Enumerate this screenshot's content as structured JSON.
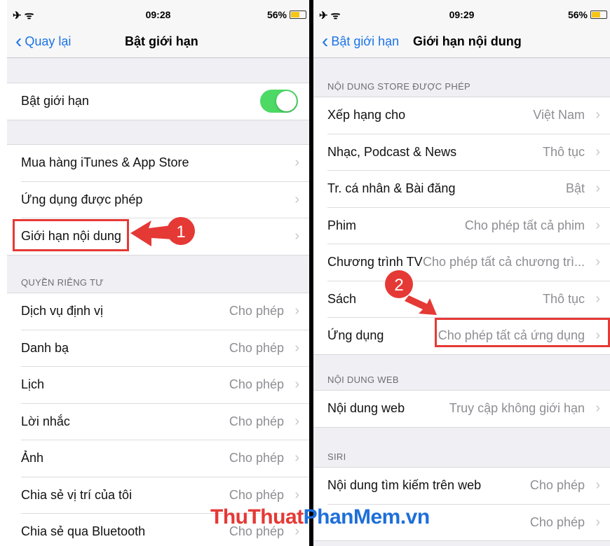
{
  "left": {
    "status": {
      "time": "09:28",
      "battery": "56%",
      "icons": "✈ ᯤ"
    },
    "nav": {
      "back": "Quay lại",
      "title": "Bật giới hạn"
    },
    "toggle_row": {
      "label": "Bật giới hạn",
      "on": true
    },
    "group1": [
      {
        "label": "Mua hàng iTunes & App Store"
      },
      {
        "label": "Ứng dụng được phép"
      },
      {
        "label": "Giới hạn nội dung"
      }
    ],
    "privacy_header": "QUYỀN RIÊNG TƯ",
    "privacy": [
      {
        "label": "Dịch vụ định vị",
        "value": "Cho phép"
      },
      {
        "label": "Danh bạ",
        "value": "Cho phép"
      },
      {
        "label": "Lịch",
        "value": "Cho phép"
      },
      {
        "label": "Lời nhắc",
        "value": "Cho phép"
      },
      {
        "label": "Ảnh",
        "value": "Cho phép"
      },
      {
        "label": "Chia sẻ vị trí của tôi",
        "value": "Cho phép"
      },
      {
        "label": "Chia sẻ qua Bluetooth",
        "value": "Cho phép"
      }
    ],
    "badge": "1"
  },
  "right": {
    "status": {
      "time": "09:29",
      "battery": "56%",
      "icons": "✈ ᯤ"
    },
    "nav": {
      "back": "Bật giới hạn",
      "title": "Giới hạn nội dung"
    },
    "store_header": "NỘI DUNG STORE ĐƯỢC PHÉP",
    "store": [
      {
        "label": "Xếp hạng cho",
        "value": "Việt Nam"
      },
      {
        "label": "Nhạc, Podcast & News",
        "value": "Thô tục"
      },
      {
        "label": "Tr. cá nhân & Bài đăng",
        "value": "Bật"
      },
      {
        "label": "Phim",
        "value": "Cho phép tất cả phim"
      },
      {
        "label": "Chương trình TV",
        "value": "Cho phép tất cả chương trì..."
      },
      {
        "label": "Sách",
        "value": "Thô tục"
      },
      {
        "label": "Ứng dụng",
        "value": "Cho phép tất cả ứng dụng"
      }
    ],
    "web_header": "NỘI DUNG WEB",
    "web": [
      {
        "label": "Nội dung web",
        "value": "Truy cập không giới hạn"
      }
    ],
    "siri_header": "SIRI",
    "siri": [
      {
        "label": "Nội dung tìm kiếm trên web",
        "value": "Cho phép"
      },
      {
        "label": "",
        "value": "Cho phép"
      }
    ],
    "badge": "2"
  },
  "watermark": {
    "part1": "ThuThuat",
    "part2": "PhanMem",
    "part3": ".vn"
  },
  "colors": {
    "accent": "#1a73e8",
    "toggle_on": "#4cd964",
    "highlight": "#e53935"
  }
}
